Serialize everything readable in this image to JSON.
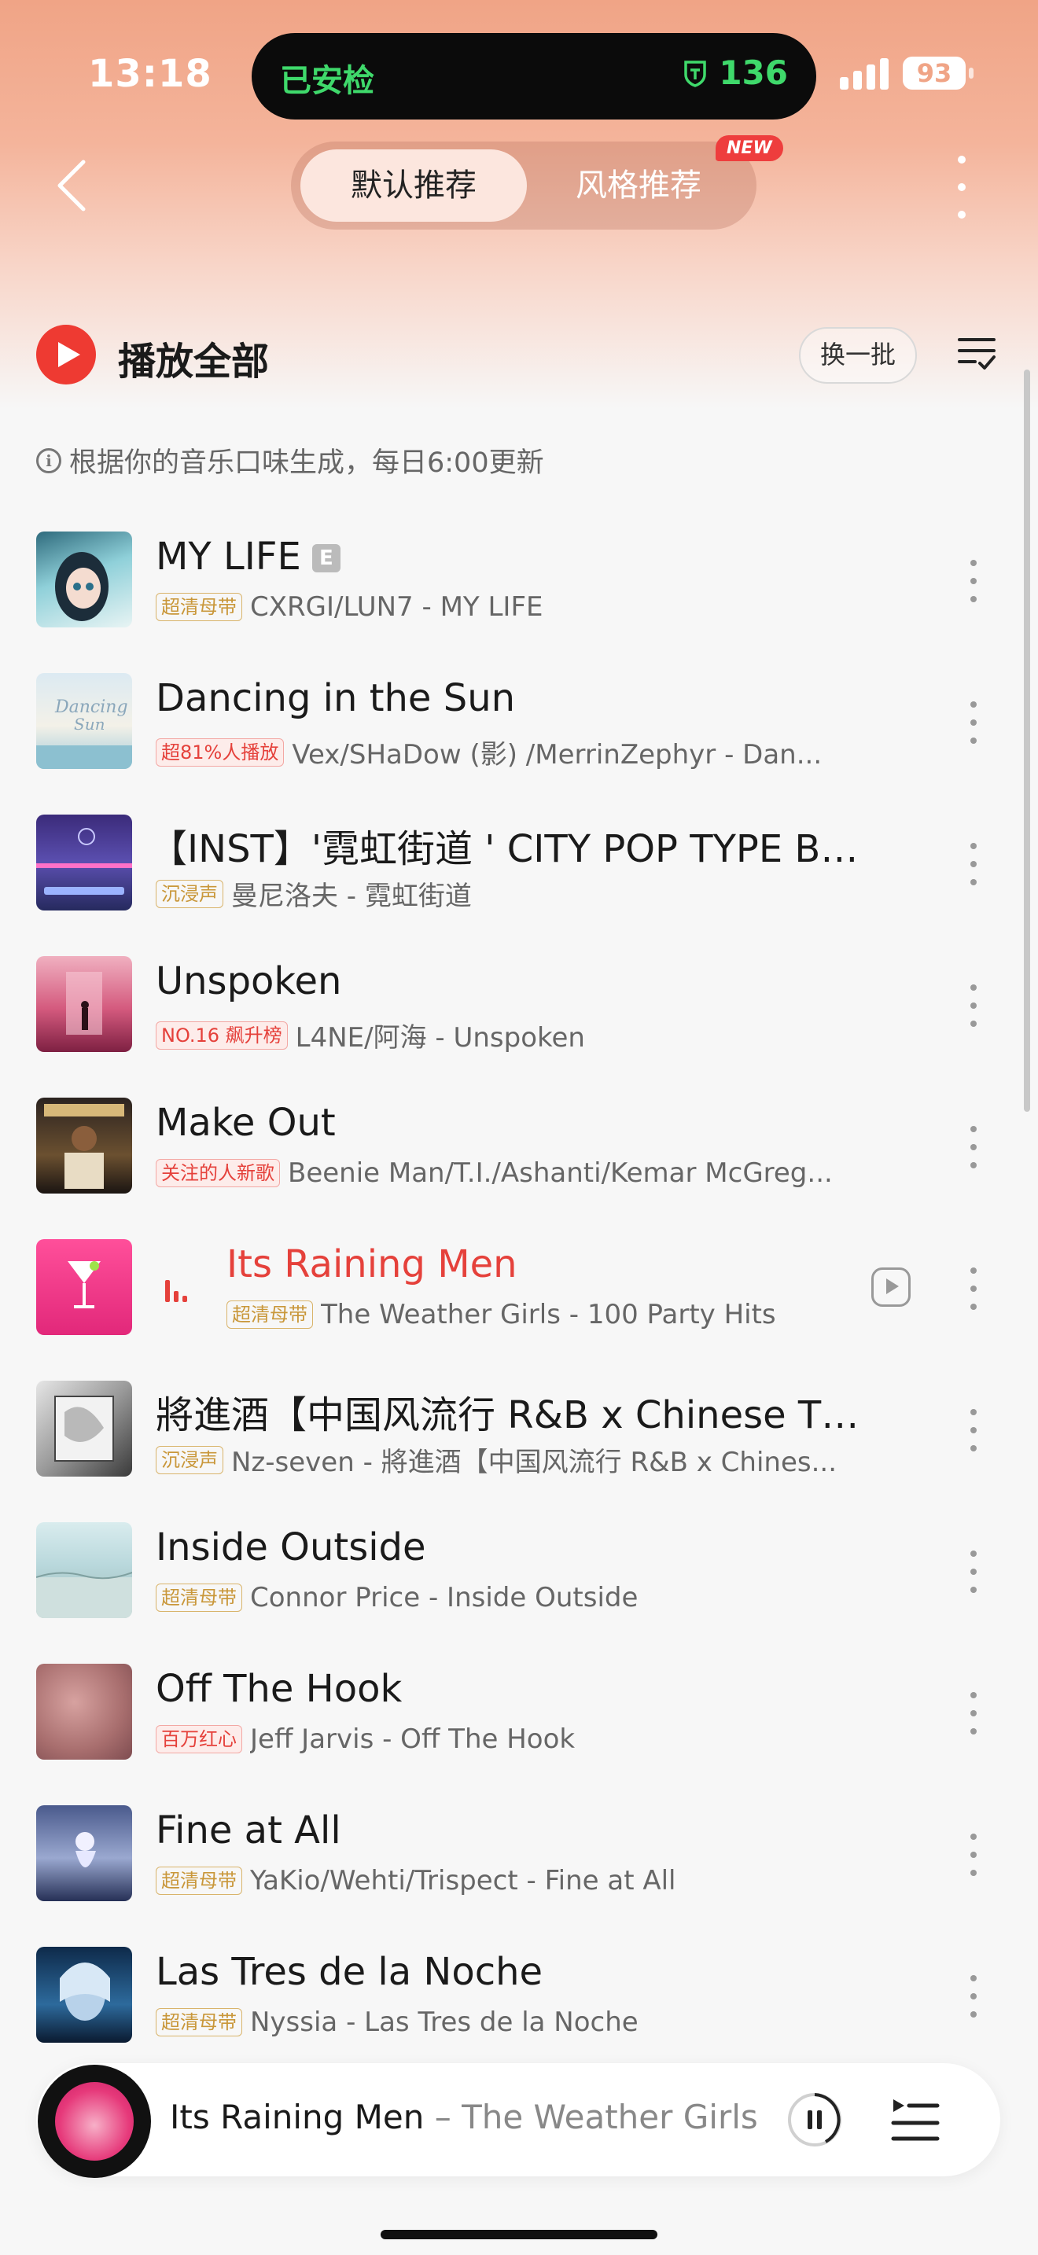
{
  "status_bar": {
    "time": "13:18",
    "island_left": "已安检",
    "island_right": "136",
    "battery": "93"
  },
  "nav": {
    "tab_default": "默认推荐",
    "tab_style": "风格推荐",
    "new_badge": "NEW"
  },
  "header": {
    "play_all": "播放全部",
    "refresh": "换一批",
    "info": "根据你的音乐口味生成，每日6:00更新"
  },
  "songs": [
    {
      "title": "MY LIFE",
      "explicit": "E",
      "tag": "超清母带",
      "tag_style": "gold",
      "subtitle": "CXRGI/LUN7 - MY LIFE"
    },
    {
      "title": "Dancing in the Sun",
      "tag": "超81%人播放",
      "tag_style": "red",
      "subtitle": "Vex/SHaDow (影) /MerrinZephyr - Dan..."
    },
    {
      "title": "【INST】'霓虹街道 ' CITY POP TYPE BEAT",
      "tag": "沉浸声",
      "tag_style": "gold",
      "subtitle": "曼尼洛夫 - 霓虹街道"
    },
    {
      "title": "Unspoken",
      "tag": "NO.16 飙升榜",
      "tag_style": "red",
      "subtitle": "L4NE/阿海 - Unspoken"
    },
    {
      "title": "Make Out",
      "tag": "关注的人新歌",
      "tag_style": "red",
      "subtitle": "Beenie Man/T.I./Ashanti/Kemar McGreg..."
    },
    {
      "title": "Its Raining Men",
      "tag": "超清母带",
      "tag_style": "gold",
      "subtitle": "The Weather Girls - 100 Party Hits",
      "playing": true
    },
    {
      "title": "將進酒【中国风流行 R&B x Chinese TYP...",
      "tag": "沉浸声",
      "tag_style": "gold",
      "subtitle": "Nz-seven - 將進酒【中国风流行 R&B x Chines..."
    },
    {
      "title": "Inside Outside",
      "tag": "超清母带",
      "tag_style": "gold",
      "subtitle": "Connor Price - Inside Outside"
    },
    {
      "title": "Off The Hook",
      "tag": "百万红心",
      "tag_style": "red",
      "subtitle": "Jeff Jarvis - Off The Hook"
    },
    {
      "title": "Fine at All",
      "tag": "超清母带",
      "tag_style": "gold",
      "subtitle": "YaKio/Wehti/Trispect - Fine at All"
    },
    {
      "title": "Las Tres de la Noche",
      "tag": "超清母带",
      "tag_style": "gold",
      "subtitle": "Nyssia - Las Tres de la Noche"
    }
  ],
  "mini_player": {
    "title": "Its Raining Men",
    "separator": " – ",
    "artist": "The Weather Girls"
  },
  "colors": {
    "accent": "#e5413b",
    "gradient_top": "#f0a486",
    "island_text": "#3fd96b"
  }
}
